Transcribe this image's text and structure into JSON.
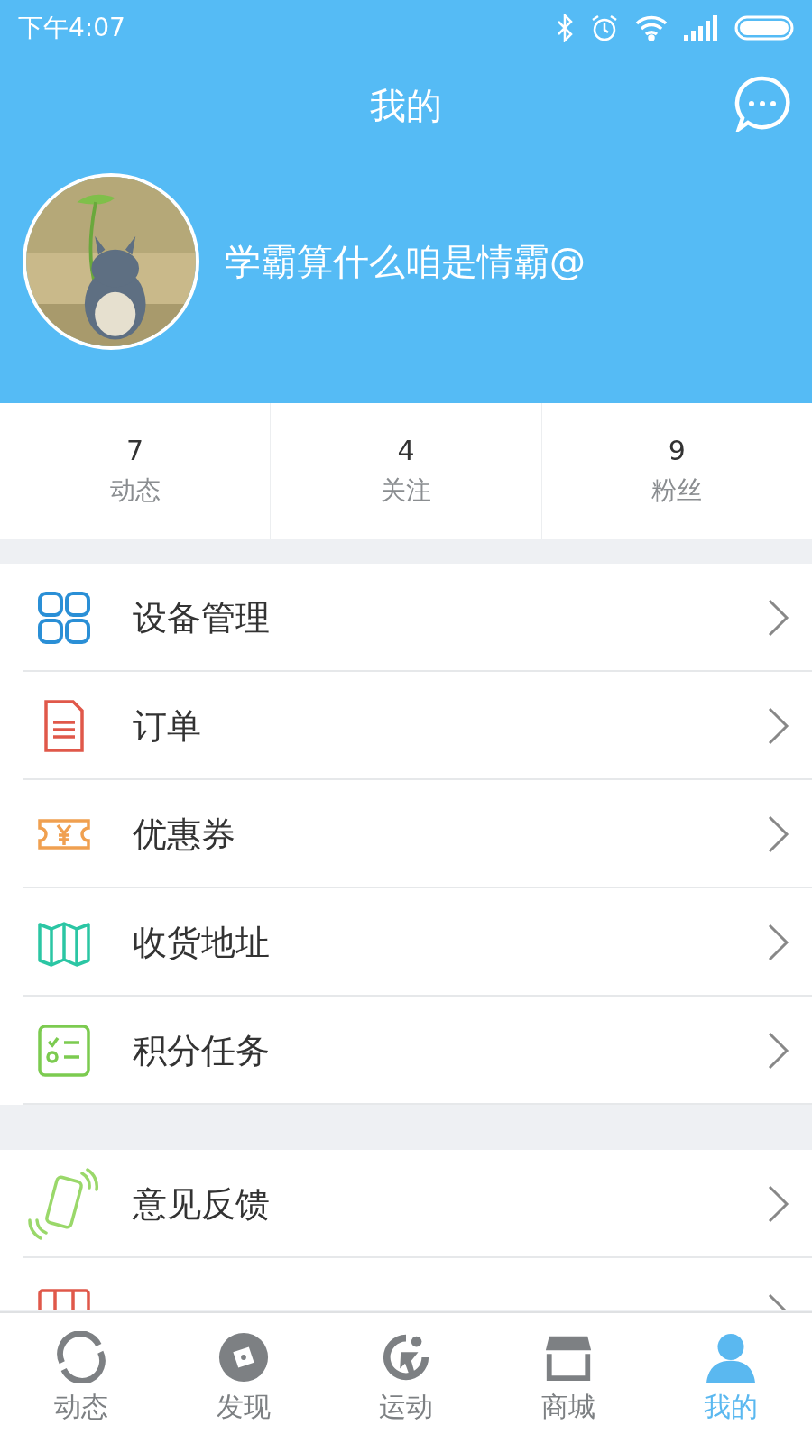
{
  "status_bar": {
    "time": "下午4:07"
  },
  "header": {
    "title": "我的"
  },
  "profile": {
    "name": "学霸算什么咱是情霸@"
  },
  "stats": [
    {
      "count": "7",
      "label": "动态"
    },
    {
      "count": "4",
      "label": "关注"
    },
    {
      "count": "9",
      "label": "粉丝"
    }
  ],
  "menu_groups": [
    {
      "items": [
        {
          "kind": "devices",
          "label": "设备管理"
        },
        {
          "kind": "order",
          "label": "订单"
        },
        {
          "kind": "coupon",
          "label": "优惠券"
        },
        {
          "kind": "address",
          "label": "收货地址"
        },
        {
          "kind": "tasks",
          "label": "积分任务"
        }
      ]
    },
    {
      "items": [
        {
          "kind": "feedback",
          "label": "意见反馈"
        },
        {
          "kind": "help"
        }
      ]
    }
  ],
  "tab_bar": [
    {
      "kind": "feed",
      "label": "动态",
      "selected": false
    },
    {
      "kind": "discover",
      "label": "发现",
      "selected": false
    },
    {
      "kind": "sport",
      "label": "运动",
      "selected": false
    },
    {
      "kind": "store",
      "label": "商城",
      "selected": false
    },
    {
      "kind": "me",
      "label": "我的",
      "selected": true
    }
  ]
}
